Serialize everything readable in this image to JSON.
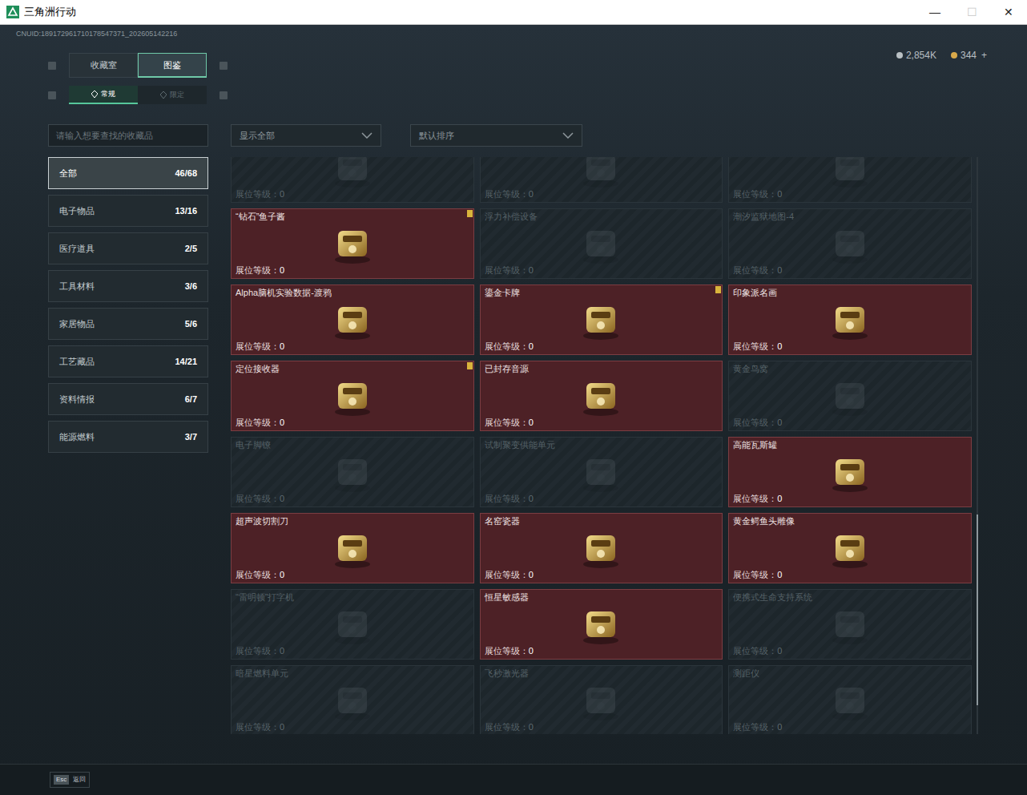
{
  "window": {
    "title": "三角洲行动",
    "controls": [
      {
        "glyph": "—",
        "disabled": false
      },
      {
        "glyph": "☐",
        "disabled": true
      },
      {
        "glyph": "✕",
        "disabled": false
      }
    ]
  },
  "uid": "CNUID:189172961710178547371_202605142216",
  "currency": [
    {
      "amount": "2,854K",
      "color": "#b9c0c4",
      "plus": ""
    },
    {
      "amount": "344",
      "color": "#d9a94a",
      "plus": "+"
    }
  ],
  "tabs": [
    {
      "label": "收藏室",
      "selected": false
    },
    {
      "label": "图鉴",
      "selected": true
    }
  ],
  "subtabs": [
    {
      "label": "常规",
      "selected": true
    },
    {
      "label": "限定",
      "selected": false
    }
  ],
  "search": {
    "placeholder": "请输入想要查找的收藏品"
  },
  "filters": [
    {
      "label": "显示全部",
      "width": "wide"
    },
    {
      "label": "默认排序",
      "width": "wider"
    }
  ],
  "sidebar": {
    "items": [
      {
        "label": "全部",
        "count": "46/68",
        "selected": true
      },
      {
        "label": "电子物品",
        "count": "13/16",
        "selected": false
      },
      {
        "label": "医疗道具",
        "count": "2/5",
        "selected": false
      },
      {
        "label": "工具材料",
        "count": "3/6",
        "selected": false
      },
      {
        "label": "家居物品",
        "count": "5/6",
        "selected": false
      },
      {
        "label": "工艺藏品",
        "count": "14/21",
        "selected": false
      },
      {
        "label": "资料情报",
        "count": "6/7",
        "selected": false
      },
      {
        "label": "能源燃料",
        "count": "3/7",
        "selected": false
      }
    ]
  },
  "level_label": "展位等级：",
  "items": [
    {
      "name": "",
      "owned": false,
      "marked": false,
      "level": "0"
    },
    {
      "name": "",
      "owned": false,
      "marked": false,
      "level": "0"
    },
    {
      "name": "",
      "owned": false,
      "marked": false,
      "level": "0"
    },
    {
      "name": "“钻石”鱼子酱",
      "owned": true,
      "marked": true,
      "level": "0"
    },
    {
      "name": "浮力补偿设备",
      "owned": false,
      "marked": false,
      "level": "0"
    },
    {
      "name": "潮汐监狱地图-4",
      "owned": false,
      "marked": false,
      "level": "0"
    },
    {
      "name": "Alpha脑机实验数据-渡鸦",
      "owned": true,
      "marked": false,
      "level": "0"
    },
    {
      "name": "鎏金卡牌",
      "owned": true,
      "marked": true,
      "level": "0"
    },
    {
      "name": "印象派名画",
      "owned": true,
      "marked": false,
      "level": "0"
    },
    {
      "name": "定位接收器",
      "owned": true,
      "marked": true,
      "level": "0"
    },
    {
      "name": "已封存音源",
      "owned": true,
      "marked": false,
      "level": "0"
    },
    {
      "name": "黄金鸟窝",
      "owned": false,
      "marked": false,
      "level": "0"
    },
    {
      "name": "电子脚镣",
      "owned": false,
      "marked": false,
      "level": "0"
    },
    {
      "name": "试制聚变供能单元",
      "owned": false,
      "marked": false,
      "level": "0"
    },
    {
      "name": "高能瓦斯罐",
      "owned": true,
      "marked": false,
      "level": "0"
    },
    {
      "name": "超声波切割刀",
      "owned": true,
      "marked": false,
      "level": "0"
    },
    {
      "name": "名窑瓷器",
      "owned": true,
      "marked": false,
      "level": "0"
    },
    {
      "name": "黄金鳄鱼头雕像",
      "owned": true,
      "marked": false,
      "level": "0"
    },
    {
      "name": "“雷明顿”打字机",
      "owned": false,
      "marked": false,
      "level": "0"
    },
    {
      "name": "恒星敏感器",
      "owned": true,
      "marked": false,
      "level": "0"
    },
    {
      "name": "便携式生命支持系统",
      "owned": false,
      "marked": false,
      "level": "0"
    },
    {
      "name": "暗星燃料单元",
      "owned": false,
      "marked": false,
      "level": "0"
    },
    {
      "name": "飞秒激光器",
      "owned": false,
      "marked": false,
      "level": "0"
    },
    {
      "name": "测距仪",
      "owned": false,
      "marked": false,
      "level": "0"
    }
  ],
  "scrollbar": {
    "thumb_start": 0.62,
    "thumb_size": 0.33
  },
  "footer": {
    "key": "Esc",
    "label": "返回"
  }
}
